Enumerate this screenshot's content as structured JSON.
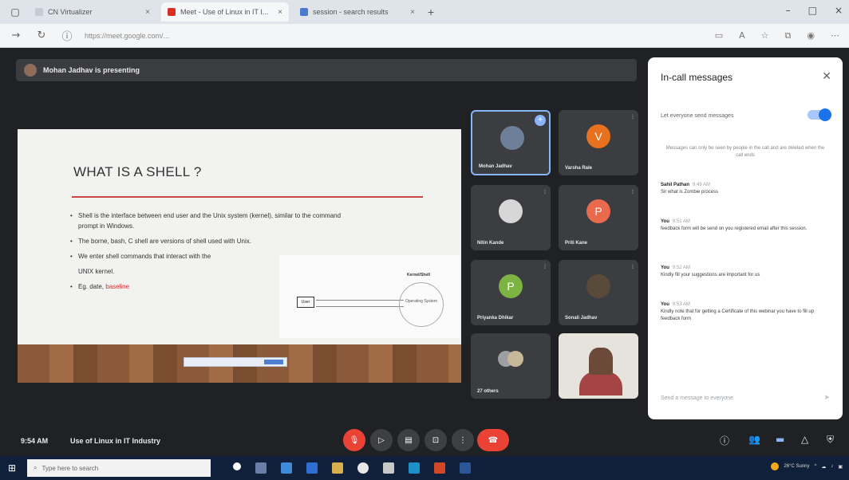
{
  "browser": {
    "tabs": [
      {
        "label": "CN Virtualizer",
        "color": "#c6cbd3"
      },
      {
        "label": "Meet - Use of Linux in IT I...",
        "color": "#d93025"
      },
      {
        "label": "session - search results",
        "color": "#4a7bd0"
      }
    ],
    "address": "https://meet.google.com/..."
  },
  "presentation_banner": "Mohan Jadhav is presenting",
  "slide": {
    "title": "WHAT IS A SHELL ?",
    "bullets": [
      {
        "text": "Shell is the interface between end user and the Unix system (kernel), similar to the command prompt in Windows."
      },
      {
        "text": "The borne, bash, C shell are versions of shell used with Unix."
      },
      {
        "text": "We enter shell commands that interact with the"
      },
      {
        "text": "UNIX kernel."
      },
      {
        "text_prefix": "Eg. date, ",
        "text_highlight": "baseline"
      }
    ],
    "diagram": {
      "user_box": "User",
      "title": "Kernel/Shell",
      "circle": "Operating System"
    }
  },
  "participants": [
    {
      "name": "Mohan Jadhav",
      "avatar_letter": "",
      "avatar_color": "#6e7f9a",
      "pinned": true
    },
    {
      "name": "Varsha Rale",
      "avatar_letter": "V",
      "avatar_color": "#e8711f"
    },
    {
      "name": "Nitin Kande",
      "avatar_letter": "",
      "avatar_color": "#d7d7d7"
    },
    {
      "name": "Priti Kane",
      "avatar_letter": "P",
      "avatar_color": "#ea6a4e"
    },
    {
      "name": "Priyanka Dhikar",
      "avatar_letter": "P",
      "avatar_color": "#7cb342"
    },
    {
      "name": "Sonali Jadhav",
      "avatar_letter": "",
      "avatar_color": "#5a4a3a"
    },
    {
      "name": "27 others",
      "avatar_letter": "",
      "avatar_color": ""
    }
  ],
  "chat": {
    "title": "In-call messages",
    "toggle_label": "Let everyone send messages",
    "notice": "Messages can only be seen by people in the call and are deleted when the call ends",
    "messages": [
      {
        "who": "Sahil Pathan",
        "time": "9:49 AM",
        "text": "Sir what is Zombie process"
      },
      {
        "who": "You",
        "time": "9:51 AM",
        "text": "feedback form will be send on you registered email after this session."
      },
      {
        "who": "You",
        "time": "9:52 AM",
        "text": "Kindly fill your suggestions are important for us"
      },
      {
        "who": "You",
        "time": "9:53 AM",
        "text": "Kindly note that for getting a Certificate of this webinar you have to fill up feedback form"
      }
    ],
    "input_placeholder": "Send a message to everyone"
  },
  "bottom": {
    "clock": "9:54 AM",
    "meeting_title": "Use of Linux in IT Industry"
  },
  "taskbar": {
    "search_placeholder": "Type here to search",
    "weather": "26°C Sunny"
  }
}
